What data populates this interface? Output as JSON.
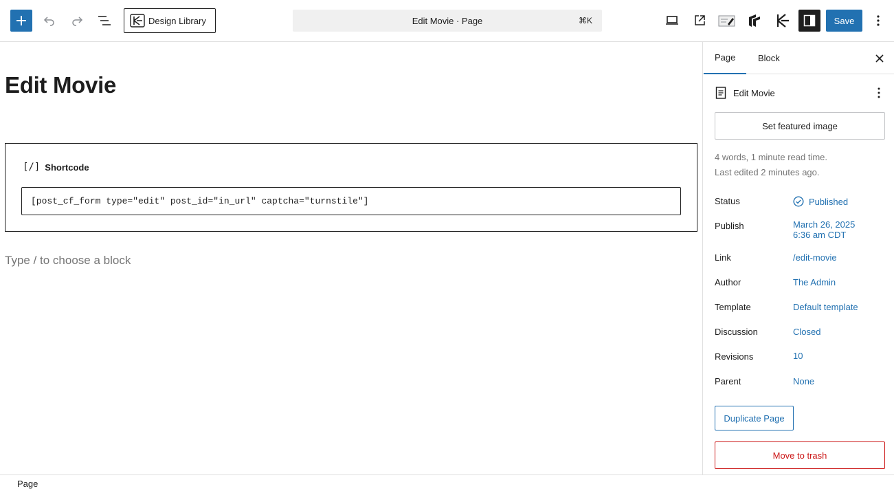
{
  "toolbar": {
    "design_library_label": "Design Library",
    "command_title": "Edit Movie · Page",
    "command_shortcut": "⌘K",
    "save_label": "Save"
  },
  "editor": {
    "page_title": "Edit Movie",
    "shortcode_block": {
      "label": "Shortcode",
      "glyph": "[/]",
      "value": "[post_cf_form type=\"edit\" post_id=\"in_url\" captcha=\"turnstile\"]"
    },
    "appender_placeholder": "Type / to choose a block"
  },
  "footer": {
    "breadcrumb": "Page"
  },
  "sidebar": {
    "tabs": [
      {
        "label": "Page",
        "active": true
      },
      {
        "label": "Block",
        "active": false
      }
    ],
    "document_title": "Edit Movie",
    "featured_image_label": "Set featured image",
    "read_time": "4 words, 1 minute read time.",
    "last_edited": "Last edited 2 minutes ago.",
    "rows": {
      "status": {
        "label": "Status",
        "value": "Published"
      },
      "publish": {
        "label": "Publish",
        "date": "March 26, 2025",
        "time": "6:36 am CDT"
      },
      "link": {
        "label": "Link",
        "value": "/edit-movie"
      },
      "author": {
        "label": "Author",
        "value": "The Admin"
      },
      "template": {
        "label": "Template",
        "value": "Default template"
      },
      "discussion": {
        "label": "Discussion",
        "value": "Closed"
      },
      "revisions": {
        "label": "Revisions",
        "value": "10"
      },
      "parent": {
        "label": "Parent",
        "value": "None"
      }
    },
    "duplicate_label": "Duplicate Page",
    "trash_label": "Move to trash"
  },
  "colors": {
    "accent": "#2271b1",
    "danger": "#cc1818",
    "text": "#1e1e1e",
    "muted": "#757575",
    "dark_toggle": "#1e1e1e"
  },
  "icons": {
    "inserter": "plus-icon",
    "undo": "undo-icon",
    "redo": "redo-icon",
    "list_view": "list-view-icon",
    "preview": "laptop-icon",
    "view_post": "external-link-icon",
    "settings": "sidebar-toggle-icon",
    "more": "vertical-ellipsis-icon"
  }
}
